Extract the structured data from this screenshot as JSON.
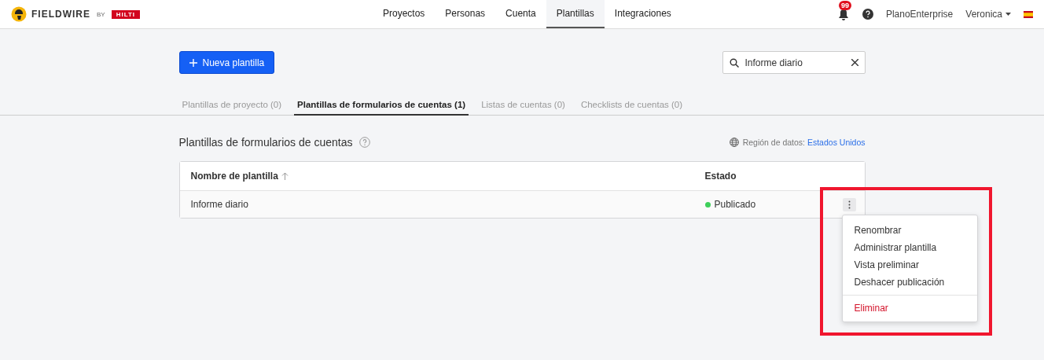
{
  "header": {
    "brand": "FIELDWIRE",
    "by": "BY",
    "partner": "HILTI",
    "nav": [
      {
        "label": "Proyectos",
        "selected": false
      },
      {
        "label": "Personas",
        "selected": false
      },
      {
        "label": "Cuenta",
        "selected": false
      },
      {
        "label": "Plantillas",
        "selected": true
      },
      {
        "label": "Integraciones",
        "selected": false
      }
    ],
    "notifications": "99",
    "plan": "PlanoEnterprise",
    "user": "Veronica"
  },
  "new_button": "Nueva plantilla",
  "search": {
    "value": "Informe diario"
  },
  "tabs": [
    {
      "label": "Plantillas de proyecto (0)",
      "selected": false
    },
    {
      "label": "Plantillas de formularios de cuentas (1)",
      "selected": true
    },
    {
      "label": "Listas de cuentas (0)",
      "selected": false
    },
    {
      "label": "Checklists de cuentas (0)",
      "selected": false
    }
  ],
  "section": {
    "title": "Plantillas de formularios de cuentas",
    "region_label": "Región de datos:",
    "region_link": "Estados Unidos"
  },
  "table": {
    "columns": [
      "Nombre de plantilla",
      "Estado"
    ],
    "rows": [
      {
        "name": "Informe diario",
        "status": "Publicado",
        "color": "#3ecf5a"
      }
    ]
  },
  "menu": [
    {
      "label": "Renombrar",
      "kind": "normal"
    },
    {
      "label": "Administrar plantilla",
      "kind": "normal"
    },
    {
      "label": "Vista preliminar",
      "kind": "normal"
    },
    {
      "label": "Deshacer publicación",
      "kind": "normal"
    },
    {
      "label": "Eliminar",
      "kind": "danger"
    }
  ],
  "highlight": true
}
